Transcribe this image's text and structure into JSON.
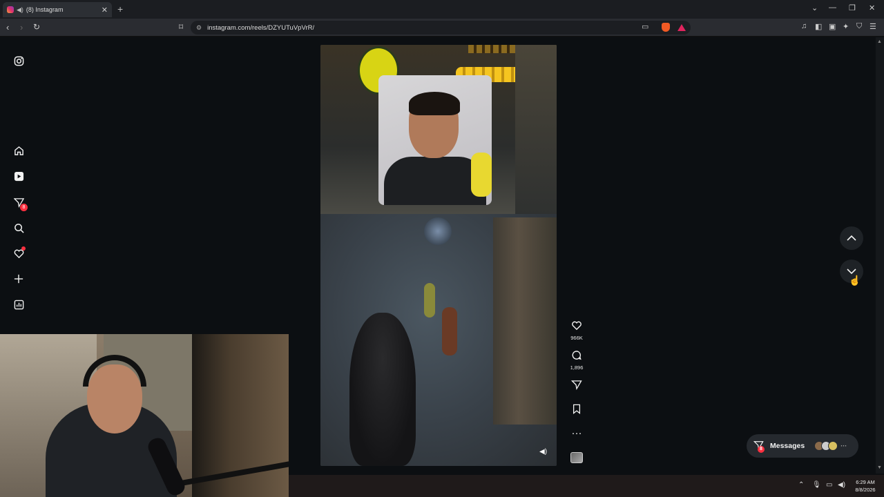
{
  "browser": {
    "tab_title": "(8) Instagram",
    "new_tab": "+",
    "url": "instagram.com/reels/DZYUTuVpVrR/",
    "window_controls": [
      "⌄",
      "—",
      "❐",
      "✕"
    ]
  },
  "sidebar": {
    "items": [
      {
        "name": "instagram-icon",
        "glyph": "◎"
      },
      {
        "name": "home-icon",
        "glyph": "⌂"
      },
      {
        "name": "reels-icon",
        "glyph": "▶"
      },
      {
        "name": "messages-icon",
        "glyph": "⟁",
        "badge": "8"
      },
      {
        "name": "search-icon",
        "glyph": "⌕"
      },
      {
        "name": "notifications-icon",
        "glyph": "♡"
      },
      {
        "name": "create-icon",
        "glyph": "+"
      },
      {
        "name": "dashboard-icon",
        "glyph": "▥"
      }
    ]
  },
  "reel": {
    "likes": "966K",
    "comments": "1,896"
  },
  "messages": {
    "label": "Messages",
    "badge": "8",
    "more": "···"
  },
  "taskbar": {
    "time": "6:29 AM",
    "date": "8/8/2026"
  },
  "colors": {
    "badge": "#ff3040",
    "page_bg": "#0c0f12"
  }
}
